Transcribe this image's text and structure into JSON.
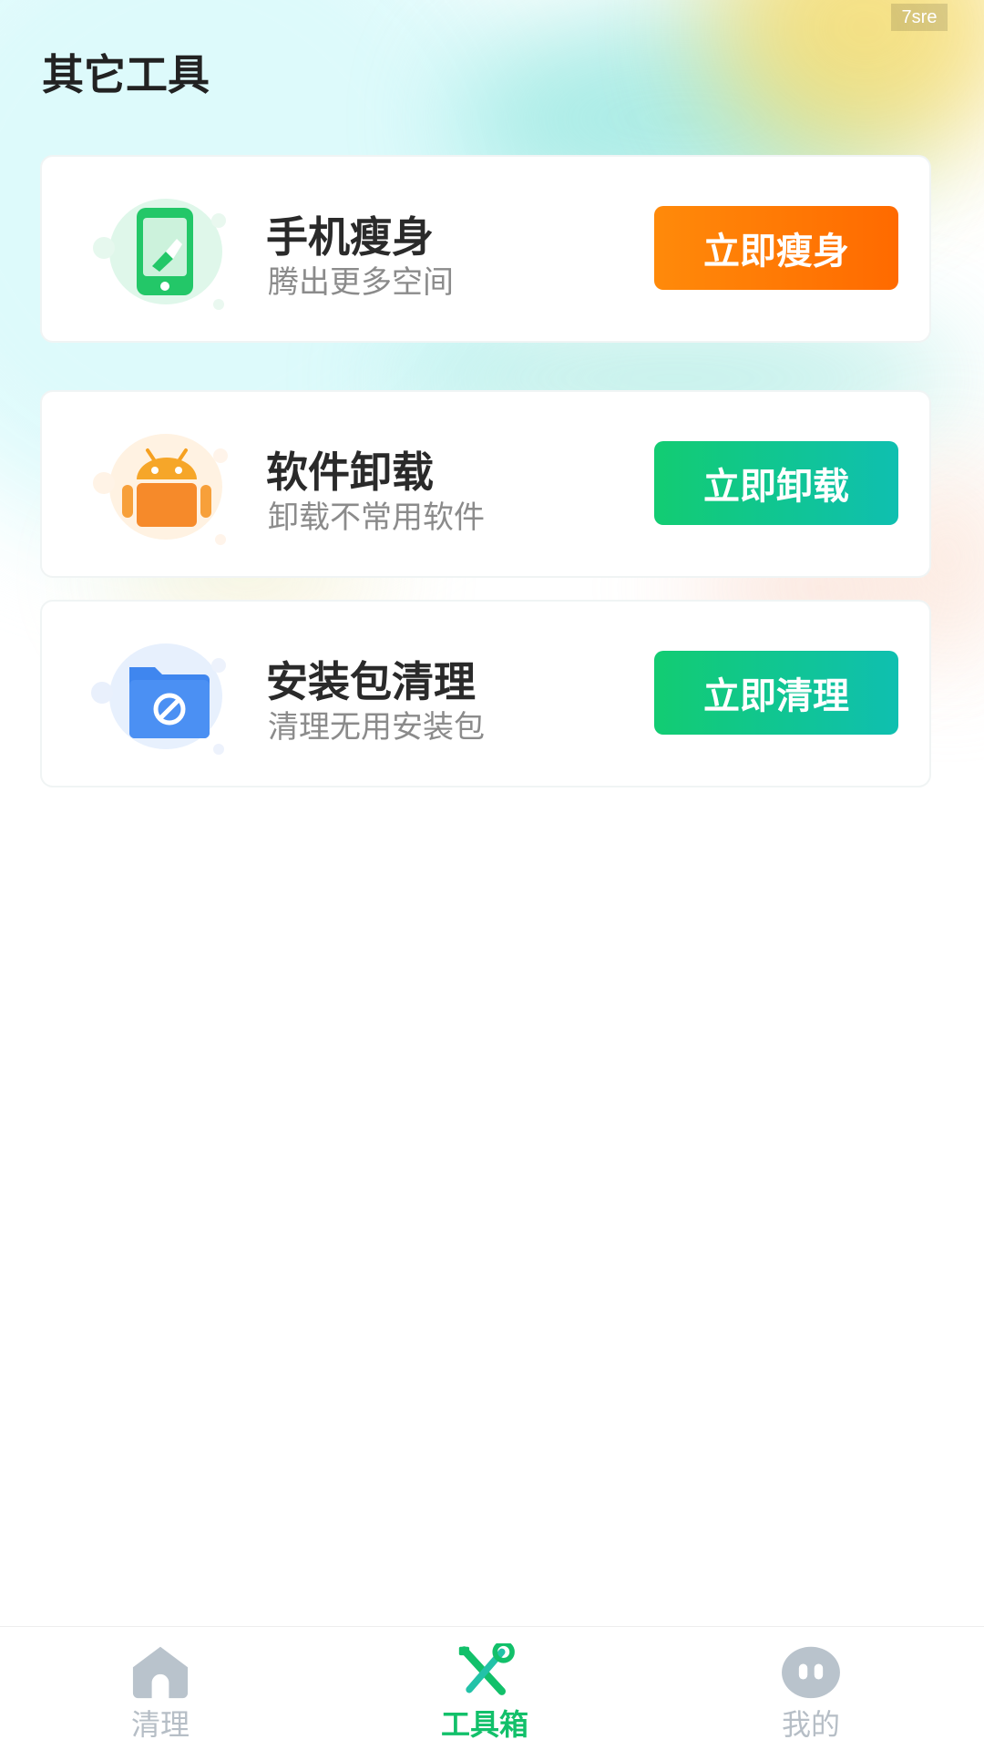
{
  "header": {
    "title": "其它工具",
    "watermark": "7sre"
  },
  "tools": [
    {
      "name": "手机瘦身",
      "desc": "腾出更多空间",
      "button": "立即瘦身",
      "icon": "phone-slim-icon",
      "accent": "#ff7a00"
    },
    {
      "name": "软件卸载",
      "desc": "卸载不常用软件",
      "button": "立即卸载",
      "icon": "android-icon",
      "accent": "#12c673"
    },
    {
      "name": "安装包清理",
      "desc": "清理无用安装包",
      "button": "立即清理",
      "icon": "folder-block-icon",
      "accent": "#12c673"
    }
  ],
  "tabbar": {
    "items": [
      {
        "label": "清理",
        "icon": "home-icon",
        "active": false
      },
      {
        "label": "工具箱",
        "icon": "tools-icon",
        "active": true
      },
      {
        "label": "我的",
        "icon": "profile-icon",
        "active": false
      }
    ]
  },
  "colors": {
    "active_tab": "#12c06a",
    "inactive_tab": "#b6bec6",
    "orange_button": "#ff7a00",
    "green_button": "#12c673"
  }
}
